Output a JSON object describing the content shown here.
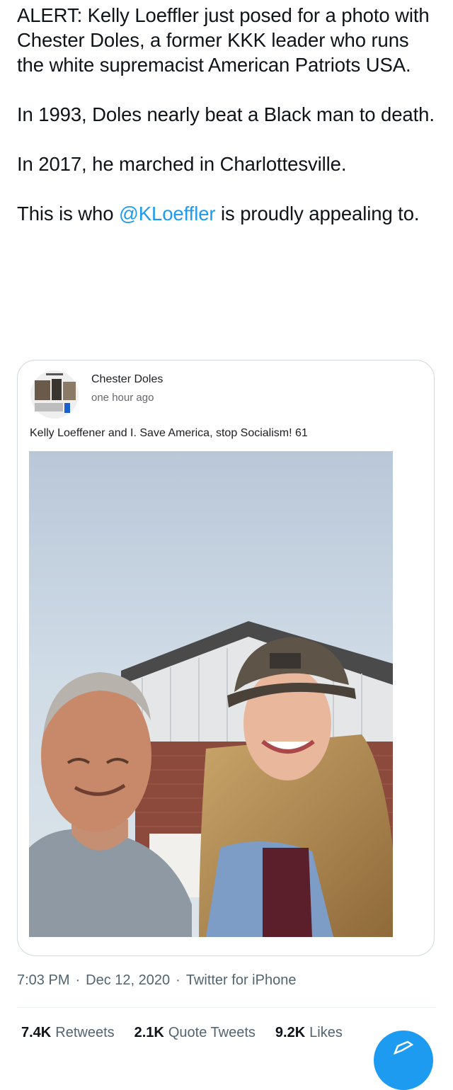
{
  "tweet": {
    "paragraph_1": "ALERT: Kelly Loeffler just posed for a photo with Chester Doles, a former KKK leader who runs the white supremacist American Patriots USA.",
    "paragraph_2": "In 1993, Doles nearly beat a Black man to death.",
    "paragraph_3": "In 2017, he marched in Charlottesville.",
    "paragraph_4_before": "This is who ",
    "mention": "@KLoeffler",
    "paragraph_4_after": " is proudly appealing to."
  },
  "quoted_post": {
    "author_name": "Chester Doles",
    "posted_time": "one hour ago",
    "text": "Kelly Loeffener and I. Save America, stop Socialism! 61"
  },
  "meta": {
    "time": "7:03 PM",
    "sep1": "·",
    "date": "Dec 12, 2020",
    "sep2": "·",
    "source": "Twitter for iPhone"
  },
  "stats": {
    "retweets_count": "7.4K",
    "retweets_label": "Retweets",
    "quotes_count": "2.1K",
    "quotes_label": "Quote Tweets",
    "likes_count": "9.2K",
    "likes_label": "Likes"
  },
  "colors": {
    "link": "#1d9bf0",
    "secondary_text": "#536471",
    "border": "#cfd9de",
    "fab": "#1d9bf0"
  },
  "icons": {
    "compose_fab": "compose-icon"
  }
}
